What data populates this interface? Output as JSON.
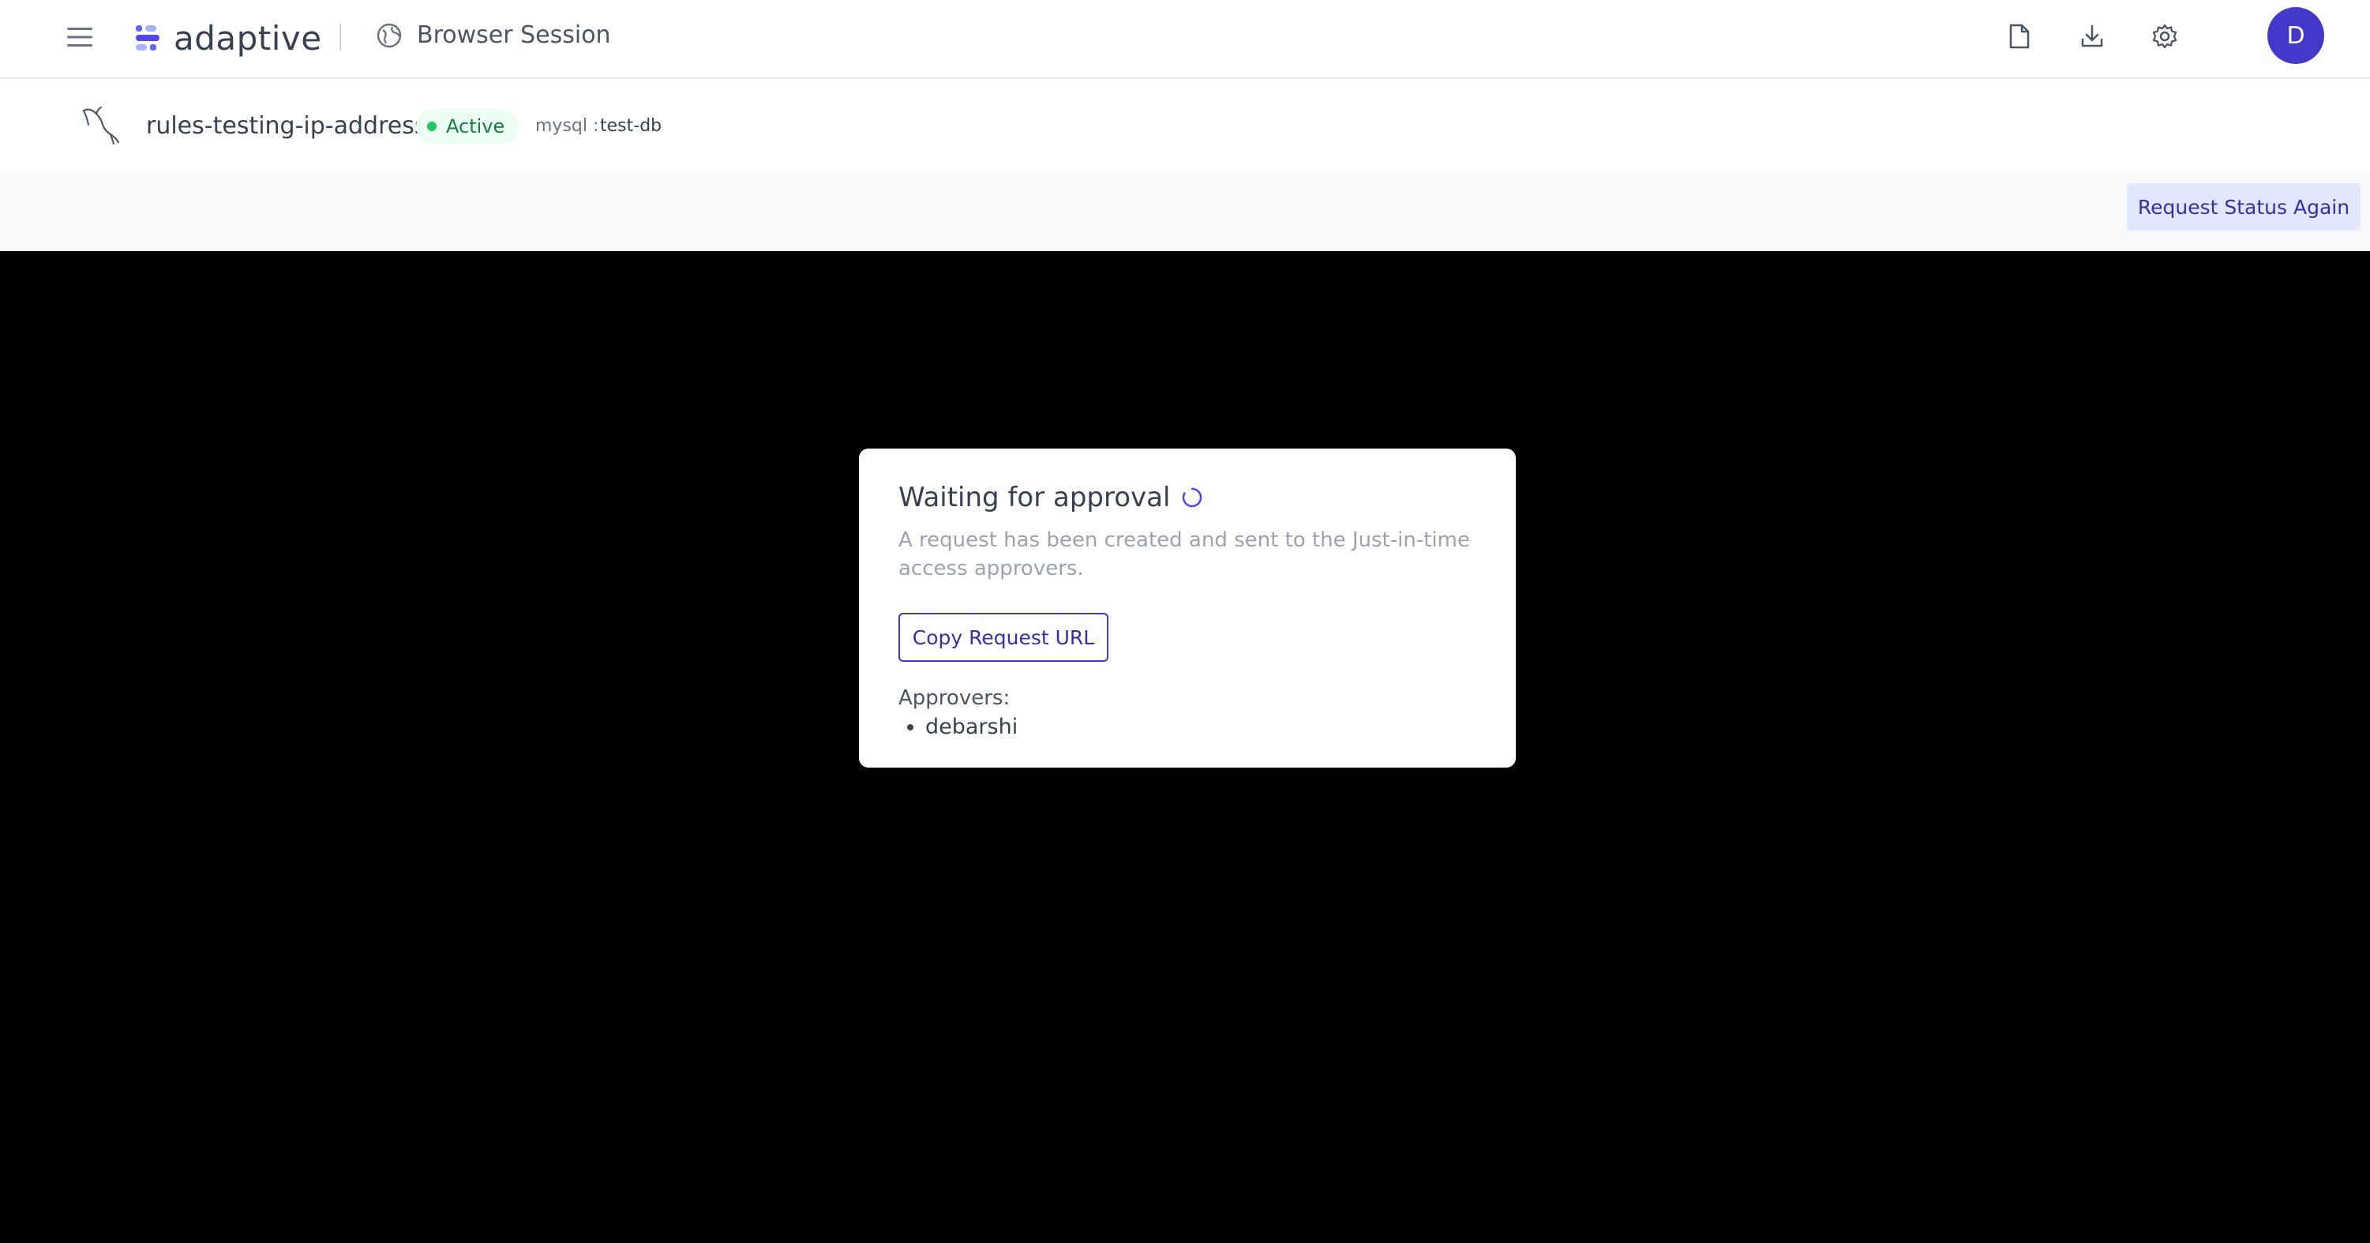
{
  "header": {
    "brand": "adaptive",
    "session_title": "Browser Session",
    "icons": {
      "menu": "menu-icon",
      "session": "globe-icon",
      "file": "file-icon",
      "download": "download-icon",
      "settings": "gear-icon"
    },
    "avatar_initial": "D",
    "avatar_color": "#4338ca"
  },
  "resource": {
    "icon": "mysql-dolphin-icon",
    "name": "rules-testing-ip-address",
    "status": "Active",
    "status_color": "#22c55e",
    "db_type_label": "mysql :",
    "db_name": "test-db"
  },
  "toolbar": {
    "request_status_again_label": "Request Status Again"
  },
  "dialog": {
    "title": "Waiting for approval",
    "description": "A request has been created and sent to the Just-in-time access approvers.",
    "copy_button_label": "Copy Request URL",
    "approvers_label": "Approvers:",
    "approvers": [
      "debarshi"
    ]
  },
  "colors": {
    "accent": "#4338ca",
    "accent_light": "#e0e7ff",
    "session_background": "#000000"
  }
}
